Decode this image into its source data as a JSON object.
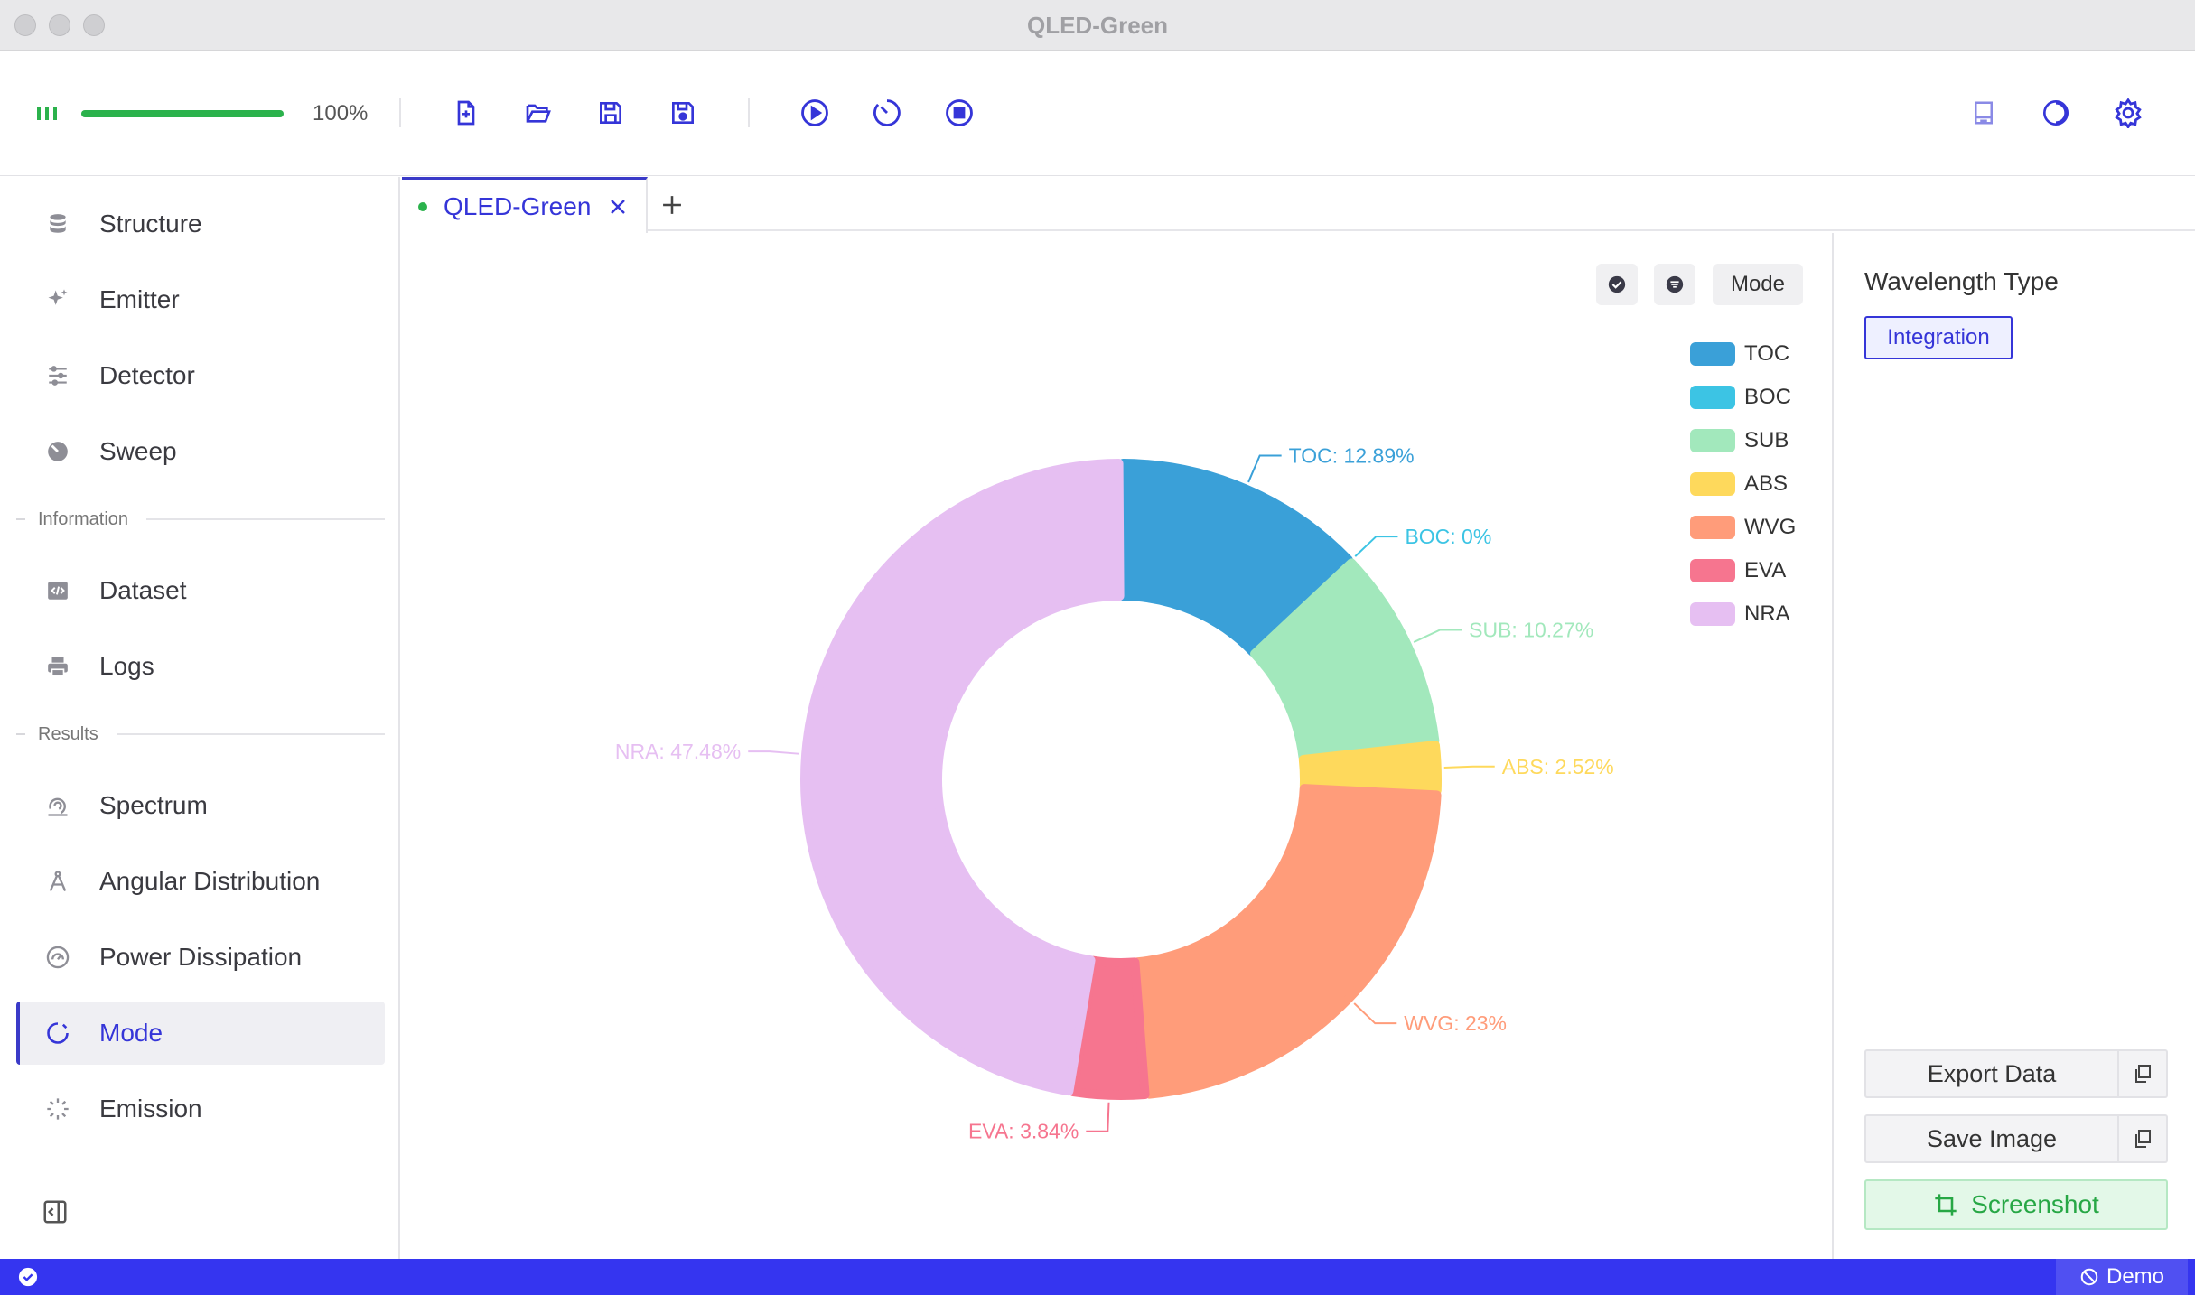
{
  "window": {
    "title": "QLED-Green"
  },
  "toolbar": {
    "progress_label": "100%",
    "progress_fraction": 1.0,
    "buttons": [
      "new-file-icon",
      "open-folder-icon",
      "save-icon",
      "save-as-icon",
      "play-icon",
      "timer-icon",
      "stop-icon",
      "document-icon",
      "theme-icon",
      "settings-icon"
    ]
  },
  "sidebar": {
    "items_top": [
      {
        "label": "Structure",
        "icon": "database-icon"
      },
      {
        "label": "Emitter",
        "icon": "sparkle-icon"
      },
      {
        "label": "Detector",
        "icon": "sliders-icon"
      },
      {
        "label": "Sweep",
        "icon": "sweep-icon"
      }
    ],
    "section_information": "Information",
    "items_info": [
      {
        "label": "Dataset",
        "icon": "code-icon"
      },
      {
        "label": "Logs",
        "icon": "printer-icon"
      }
    ],
    "section_results": "Results",
    "items_results": [
      {
        "label": "Spectrum",
        "icon": "spectrum-icon"
      },
      {
        "label": "Angular Distribution",
        "icon": "compass-icon"
      },
      {
        "label": "Power Dissipation",
        "icon": "gauge-icon"
      },
      {
        "label": "Mode",
        "icon": "mode-icon",
        "active": true
      },
      {
        "label": "Emission",
        "icon": "loader-icon"
      }
    ]
  },
  "tabs": [
    {
      "label": "QLED-Green",
      "active": true
    }
  ],
  "chart_controls": {
    "mode_label": "Mode"
  },
  "chart_data": {
    "type": "pie",
    "donut": true,
    "legend_placement": "top-right",
    "categories": [
      "TOC",
      "BOC",
      "SUB",
      "ABS",
      "WVG",
      "EVA",
      "NRA"
    ],
    "values": [
      12.89,
      0,
      10.27,
      2.52,
      23,
      3.84,
      47.48
    ],
    "labels": [
      "TOC: 12.89%",
      "BOC: 0%",
      "SUB: 10.27%",
      "ABS: 2.52%",
      "WVG: 23%",
      "EVA: 3.84%",
      "NRA: 47.48%"
    ],
    "colors": [
      "#3aa0d8",
      "#3cc4e4",
      "#a2e8bc",
      "#fed95c",
      "#ff9c7a",
      "#f6758f",
      "#e6bff2"
    ]
  },
  "right_panel": {
    "title": "Wavelength Type",
    "chip": "Integration",
    "export_data": "Export Data",
    "save_image": "Save Image",
    "screenshot": "Screenshot"
  },
  "statusbar": {
    "demo_label": "Demo"
  }
}
